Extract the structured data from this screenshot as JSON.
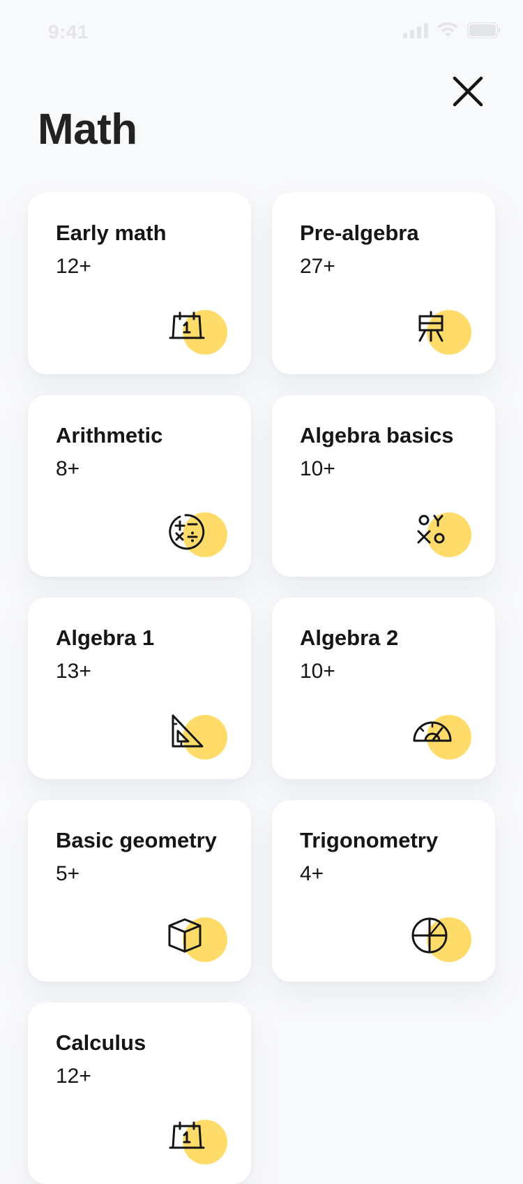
{
  "status_bar": {
    "time": "9:41"
  },
  "header": {
    "title": "Math",
    "close_icon": "close-icon"
  },
  "colors": {
    "background": "#f8f9fb",
    "card": "#ffffff",
    "accent": "#ffdc6a",
    "text": "#151515"
  },
  "topics": [
    {
      "title": "Early math",
      "count": "12+",
      "icon": "calendar-icon"
    },
    {
      "title": "Pre-algebra",
      "count": "27+",
      "icon": "easel-icon"
    },
    {
      "title": "Arithmetic",
      "count": "8+",
      "icon": "operations-icon"
    },
    {
      "title": "Algebra basics",
      "count": "10+",
      "icon": "variables-icon"
    },
    {
      "title": "Algebra 1",
      "count": "13+",
      "icon": "set-square-icon"
    },
    {
      "title": "Algebra 2",
      "count": "10+",
      "icon": "protractor-icon"
    },
    {
      "title": "Basic geometry",
      "count": "5+",
      "icon": "cube-icon"
    },
    {
      "title": "Trigonometry",
      "count": "4+",
      "icon": "circle-quadrants-icon"
    },
    {
      "title": "Calculus",
      "count": "12+",
      "icon": "calendar-icon"
    }
  ]
}
